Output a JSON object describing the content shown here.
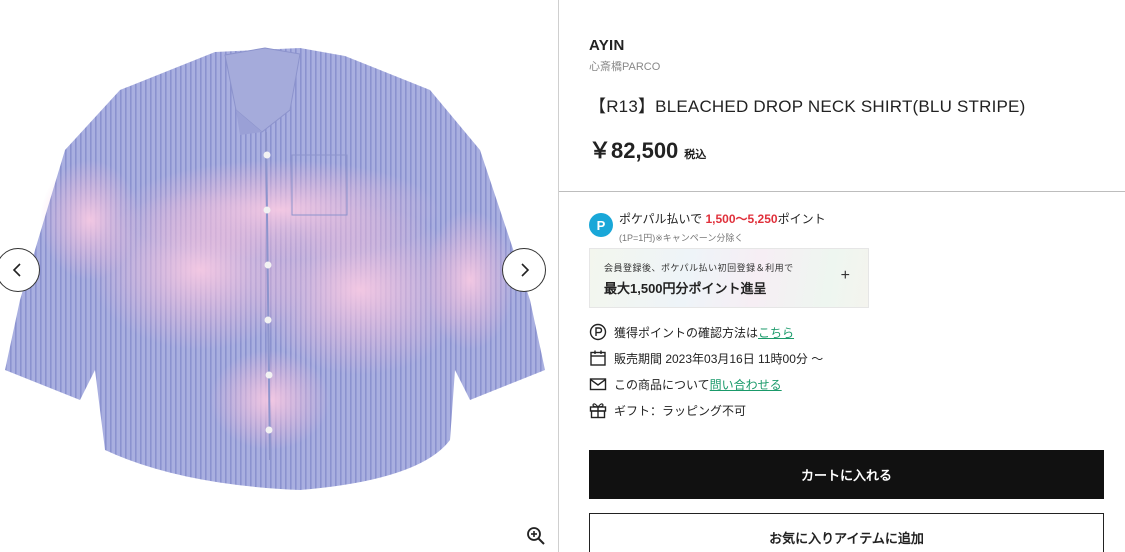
{
  "product": {
    "brand": "AYIN",
    "shop": "心斎橋PARCO",
    "title": "【R13】BLEACHED DROP NECK SHIRT(BLU STRIPE)",
    "price": "￥82,500",
    "tax_label": "税込"
  },
  "gallery": {
    "image": "shirt-image",
    "prev_icon": "chevron-left-icon",
    "next_icon": "chevron-right-icon",
    "zoom_icon": "zoom-in-icon"
  },
  "payment": {
    "logo_letter": "P",
    "text_before": "ポケパル払いで ",
    "points": "1,500〜5,250",
    "text_after": "ポイント",
    "sub": "(1P=1円)※キャンペーン分除く"
  },
  "promo": {
    "small": "会員登録後、ポケパル払い初回登録＆利用で",
    "big": "最大1,500円分ポイント進呈",
    "plus": "+"
  },
  "meta": {
    "points_check_text": "獲得ポイントの確認方法は",
    "points_check_link": "こちら",
    "sale_period": "販売期間 2023年03月16日 11時00分 ～",
    "inquiry_text": "この商品について",
    "inquiry_link": "問い合わせる",
    "gift": "ギフト：ラッピング不可"
  },
  "actions": {
    "cart": "カートに入れる",
    "favorite": "お気に入りアイテムに追加"
  },
  "colors": {
    "accent_link": "#1a9a6a",
    "points_red": "#e0303b",
    "pay_blue": "#19a7d8",
    "cart_bg": "#111111"
  }
}
